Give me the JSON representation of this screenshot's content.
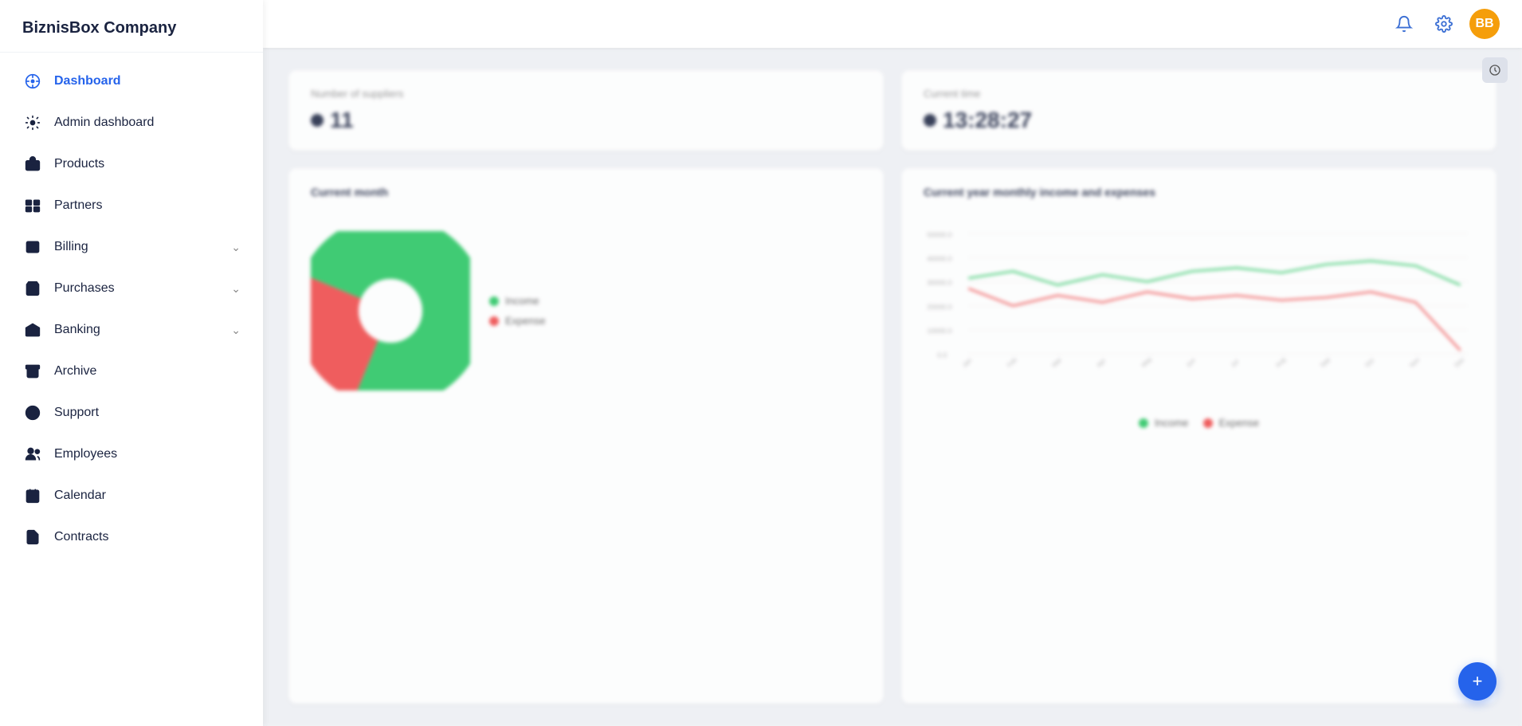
{
  "brand": {
    "name": "BiznisBox Company"
  },
  "sidebar": {
    "items": [
      {
        "id": "dashboard",
        "label": "Dashboard",
        "icon": "dashboard-icon",
        "active": true,
        "hasChevron": false
      },
      {
        "id": "admin-dashboard",
        "label": "Admin dashboard",
        "icon": "admin-icon",
        "active": false,
        "hasChevron": false
      },
      {
        "id": "products",
        "label": "Products",
        "icon": "products-icon",
        "active": false,
        "hasChevron": false
      },
      {
        "id": "partners",
        "label": "Partners",
        "icon": "partners-icon",
        "active": false,
        "hasChevron": false
      },
      {
        "id": "billing",
        "label": "Billing",
        "icon": "billing-icon",
        "active": false,
        "hasChevron": true
      },
      {
        "id": "purchases",
        "label": "Purchases",
        "icon": "purchases-icon",
        "active": false,
        "hasChevron": true
      },
      {
        "id": "banking",
        "label": "Banking",
        "icon": "banking-icon",
        "active": false,
        "hasChevron": true
      },
      {
        "id": "archive",
        "label": "Archive",
        "icon": "archive-icon",
        "active": false,
        "hasChevron": false
      },
      {
        "id": "support",
        "label": "Support",
        "icon": "support-icon",
        "active": false,
        "hasChevron": false
      },
      {
        "id": "employees",
        "label": "Employees",
        "icon": "employees-icon",
        "active": false,
        "hasChevron": false
      },
      {
        "id": "calendar",
        "label": "Calendar",
        "icon": "calendar-icon",
        "active": false,
        "hasChevron": false
      },
      {
        "id": "contracts",
        "label": "Contracts",
        "icon": "contracts-icon",
        "active": false,
        "hasChevron": false
      }
    ]
  },
  "topbar": {
    "avatar_text": "BB",
    "notifications_label": "notifications",
    "settings_label": "settings"
  },
  "content": {
    "stat_cards": [
      {
        "title": "Number of suppliers",
        "value": "11"
      },
      {
        "title": "Current time",
        "value": "13:28:27"
      }
    ],
    "pie_chart": {
      "title": "Current month",
      "segments": [
        {
          "label": "Income",
          "color": "#22c55e",
          "percent": 75
        },
        {
          "label": "Expense",
          "color": "#ef4444",
          "percent": 25
        }
      ]
    },
    "line_chart": {
      "title": "Current year monthly income and expenses",
      "legend": [
        {
          "label": "Income",
          "color": "#22c55e"
        },
        {
          "label": "Expense",
          "color": "#ef4444"
        }
      ]
    }
  },
  "fab": {
    "label": "+"
  }
}
